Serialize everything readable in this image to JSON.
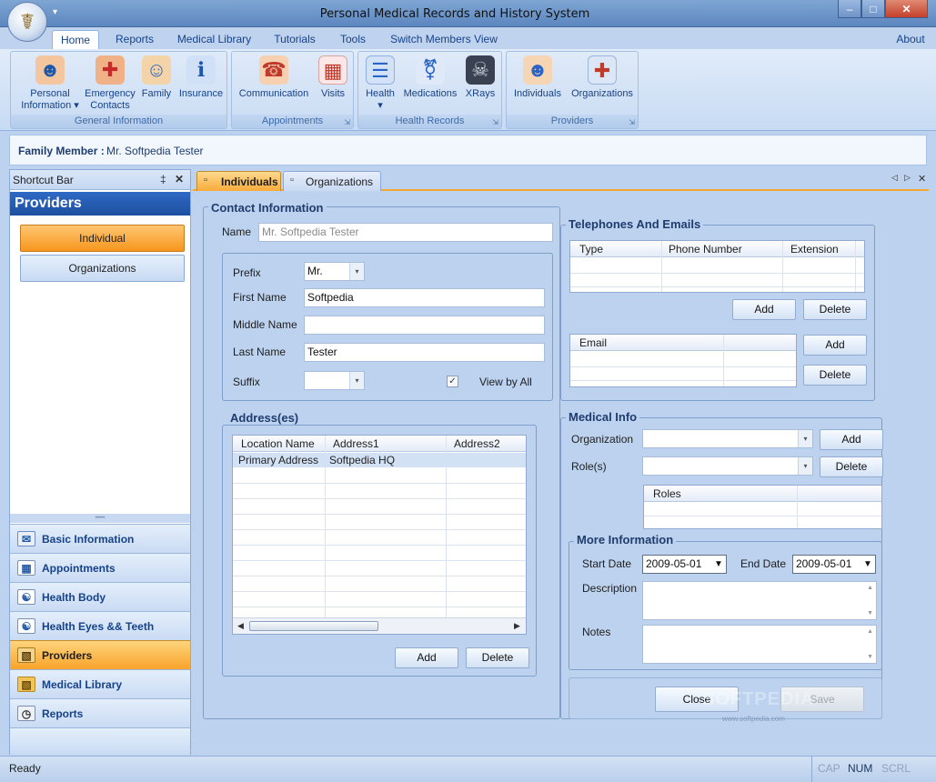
{
  "window": {
    "title": "Personal Medical Records and History System",
    "min_glyph": "‒",
    "max_glyph": "□",
    "close_glyph": "✕",
    "qat_glyph": "▾"
  },
  "ribbon": {
    "tabs": [
      "Home",
      "Reports",
      "Medical Library",
      "Tutorials",
      "Tools",
      "Switch Members View"
    ],
    "about": "About",
    "groups": [
      {
        "label": "General  Information",
        "buttons": [
          {
            "line1": "Personal",
            "line2": "Information ▾",
            "icon": "personal-info-icon"
          },
          {
            "line1": "Emergency",
            "line2": "Contacts",
            "icon": "emergency-contacts-icon"
          },
          {
            "line1": "Family",
            "line2": "",
            "icon": "family-icon"
          },
          {
            "line1": "Insurance",
            "line2": "",
            "icon": "insurance-icon"
          }
        ]
      },
      {
        "label": "Appointments",
        "buttons": [
          {
            "line1": "Communication",
            "line2": "",
            "icon": "communication-icon"
          },
          {
            "line1": "Visits",
            "line2": "",
            "icon": "visits-calendar-icon"
          }
        ]
      },
      {
        "label": "Health Records",
        "buttons": [
          {
            "line1": "Health",
            "line2": "▾",
            "icon": "health-icon"
          },
          {
            "line1": "Medications",
            "line2": "",
            "icon": "medications-icon"
          },
          {
            "line1": "XRays",
            "line2": "",
            "icon": "xrays-icon"
          }
        ]
      },
      {
        "label": "Providers",
        "buttons": [
          {
            "line1": "Individuals",
            "line2": "",
            "icon": "individuals-icon"
          },
          {
            "line1": "Organizations",
            "line2": "",
            "icon": "organizations-icon"
          }
        ]
      }
    ]
  },
  "family": {
    "label": "Family Member :",
    "value": "Mr. Softpedia Tester"
  },
  "shortcut": {
    "title": "Shortcut Bar",
    "pin": "‡",
    "close": "✕",
    "section": "Providers",
    "options": [
      "Individual",
      "Organizations"
    ],
    "grip": "•••••",
    "nav": [
      {
        "label": "Basic Information",
        "icon": "basic-information-icon",
        "active": false
      },
      {
        "label": "Appointments",
        "icon": "appointments-icon",
        "active": false
      },
      {
        "label": "Health Body",
        "icon": "health-body-icon",
        "active": false
      },
      {
        "label": "Health Eyes && Teeth",
        "icon": "health-eyes-teeth-icon",
        "active": false
      },
      {
        "label": "Providers",
        "icon": "providers-icon",
        "active": true
      },
      {
        "label": "Medical Library",
        "icon": "medical-library-icon",
        "active": false
      },
      {
        "label": "Reports",
        "icon": "reports-icon",
        "active": false
      }
    ]
  },
  "doc_tabs": [
    "Individuals",
    "Organizations"
  ],
  "doc_tab_controls": {
    "prev": "◁",
    "next": "▷",
    "close": "✕"
  },
  "contact": {
    "legend": "Contact Information",
    "name_label": "Name",
    "name_placeholder": "Mr. Softpedia  Tester",
    "prefix_label": "Prefix",
    "prefix_value": "Mr.",
    "first_label": "First Name",
    "first_value": "Softpedia",
    "middle_label": "Middle Name",
    "middle_value": "",
    "last_label": "Last Name",
    "last_value": "Tester",
    "suffix_label": "Suffix",
    "suffix_value": "",
    "view_all_label": "View by All",
    "view_all_checked": true,
    "check_glyph": "✓"
  },
  "address": {
    "legend": "Address(es)",
    "columns": [
      "Location Name",
      "Address1",
      "Address2"
    ],
    "rows": [
      [
        "Primary Address",
        "Softpedia HQ",
        ""
      ]
    ],
    "scroll_left": "◀",
    "scroll_right": "▶",
    "add": "Add",
    "delete": "Delete"
  },
  "telephones": {
    "legend": "Telephones And Emails",
    "phone_columns": [
      "Type",
      "Phone Number",
      "Extension"
    ],
    "email_columns": [
      "Email"
    ],
    "add": "Add",
    "delete": "Delete"
  },
  "medical": {
    "legend": "Medical Info",
    "org_label": "Organization",
    "role_label": "Role(s)",
    "roles_column": "Roles",
    "add": "Add",
    "delete": "Delete"
  },
  "more": {
    "legend": "More Information",
    "start_label": "Start Date",
    "start_value": "2009-05-01",
    "end_label": "End Date",
    "end_value": "2009-05-01",
    "description_label": "Description",
    "notes_label": "Notes",
    "up_glyph": "▲",
    "down_glyph": "▼",
    "combo_glyph": "▾"
  },
  "actions": {
    "close": "Close",
    "save": "Save"
  },
  "watermark": {
    "text": "SOFTPEDIA",
    "sub": "www.softpedia.com"
  },
  "status": {
    "text": "Ready",
    "cap": "CAP",
    "num": "NUM",
    "scrl": "SCRL"
  }
}
